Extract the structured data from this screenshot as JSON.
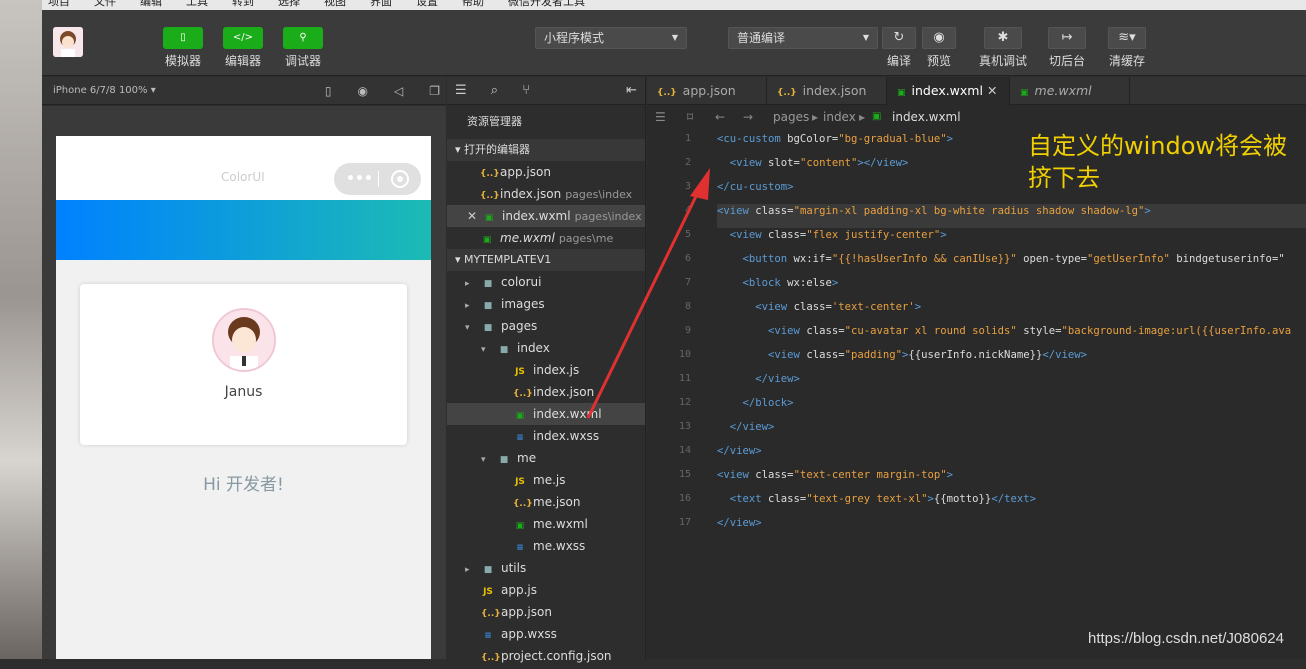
{
  "menubar": [
    "项目",
    "文件",
    "编辑",
    "工具",
    "转到",
    "选择",
    "视图",
    "界面",
    "设置",
    "帮助",
    "微信开发者工具"
  ],
  "toolbar": {
    "simulator": "模拟器",
    "editor": "编辑器",
    "debugger": "调试器",
    "mode": "小程序模式",
    "compile_mode": "普通编译",
    "compile": "编译",
    "preview": "预览",
    "remote_debug": "真机调试",
    "background": "切后台",
    "clear_cache": "清缓存"
  },
  "simulator": {
    "device": "iPhone 6/7/8 100% ▾",
    "nav_title": "ColorUI",
    "username": "Janus",
    "greeting": "Hi 开发者!"
  },
  "explorer": {
    "title": "资源管理器",
    "open_editors_label": "▾ 打开的编辑器",
    "open_editors": [
      {
        "name": "app.json",
        "hint": "",
        "type": "json",
        "close": false
      },
      {
        "name": "index.json",
        "hint": "pages\\index",
        "type": "json",
        "close": false
      },
      {
        "name": "index.wxml",
        "hint": "pages\\index",
        "type": "wxml",
        "close": true
      },
      {
        "name": "me.wxml",
        "hint": "pages\\me",
        "type": "wxml",
        "close": false
      }
    ],
    "project_label": "▾ MYTEMPLATEV1",
    "tree": [
      {
        "name": "colorui",
        "depth": 0,
        "caret": "▸",
        "type": "dir"
      },
      {
        "name": "images",
        "depth": 0,
        "caret": "▸",
        "type": "dir"
      },
      {
        "name": "pages",
        "depth": 0,
        "caret": "▾",
        "type": "dir"
      },
      {
        "name": "index",
        "depth": 1,
        "caret": "▾",
        "type": "dir"
      },
      {
        "name": "index.js",
        "depth": 2,
        "caret": "",
        "type": "js"
      },
      {
        "name": "index.json",
        "depth": 2,
        "caret": "",
        "type": "json"
      },
      {
        "name": "index.wxml",
        "depth": 2,
        "caret": "",
        "type": "wxml",
        "selected": true
      },
      {
        "name": "index.wxss",
        "depth": 2,
        "caret": "",
        "type": "wxss"
      },
      {
        "name": "me",
        "depth": 1,
        "caret": "▾",
        "type": "dir"
      },
      {
        "name": "me.js",
        "depth": 2,
        "caret": "",
        "type": "js"
      },
      {
        "name": "me.json",
        "depth": 2,
        "caret": "",
        "type": "json"
      },
      {
        "name": "me.wxml",
        "depth": 2,
        "caret": "",
        "type": "wxml"
      },
      {
        "name": "me.wxss",
        "depth": 2,
        "caret": "",
        "type": "wxss"
      },
      {
        "name": "utils",
        "depth": 0,
        "caret": "▸",
        "type": "dir"
      },
      {
        "name": "app.js",
        "depth": 0,
        "caret": "",
        "type": "js"
      },
      {
        "name": "app.json",
        "depth": 0,
        "caret": "",
        "type": "json"
      },
      {
        "name": "app.wxss",
        "depth": 0,
        "caret": "",
        "type": "wxss"
      },
      {
        "name": "project.config.json",
        "depth": 0,
        "caret": "",
        "type": "json"
      }
    ]
  },
  "editor": {
    "tabs": [
      {
        "label": "app.json",
        "type": "json"
      },
      {
        "label": "index.json",
        "type": "json"
      },
      {
        "label": "index.wxml",
        "type": "wxml",
        "active": true
      },
      {
        "label": "me.wxml",
        "type": "wxml"
      }
    ],
    "breadcrumb": [
      "pages",
      "index",
      "index.wxml"
    ],
    "lines": [
      [
        [
          "t",
          "<cu-custom "
        ],
        [
          "w",
          "bgColor="
        ],
        [
          "s",
          "\"bg-gradual-blue\""
        ],
        [
          "t",
          ">"
        ]
      ],
      [
        [
          "w",
          "  "
        ],
        [
          "t",
          "<view "
        ],
        [
          "w",
          "slot="
        ],
        [
          "s",
          "\"content\""
        ],
        [
          "t",
          "></view>"
        ]
      ],
      [
        [
          "t",
          "</cu-custom>"
        ]
      ],
      [
        [
          "t",
          "<view "
        ],
        [
          "w",
          "class="
        ],
        [
          "s",
          "\"margin-xl padding-xl bg-white radius shadow shadow-lg\""
        ],
        [
          "t",
          ">"
        ]
      ],
      [
        [
          "w",
          "  "
        ],
        [
          "t",
          "<view "
        ],
        [
          "w",
          "class="
        ],
        [
          "s",
          "\"flex justify-center\""
        ],
        [
          "t",
          ">"
        ]
      ],
      [
        [
          "w",
          "    "
        ],
        [
          "t",
          "<button "
        ],
        [
          "w",
          "wx:if="
        ],
        [
          "s",
          "\"{{!hasUserInfo && canIUse}}\""
        ],
        [
          "w",
          " open-type="
        ],
        [
          "s",
          "\"getUserInfo\""
        ],
        [
          "w",
          " bindgetuserinfo=\""
        ]
      ],
      [
        [
          "w",
          "    "
        ],
        [
          "t",
          "<block "
        ],
        [
          "w",
          "wx:else"
        ],
        [
          "t",
          ">"
        ]
      ],
      [
        [
          "w",
          "      "
        ],
        [
          "t",
          "<view "
        ],
        [
          "w",
          "class="
        ],
        [
          "s",
          "'text-center'"
        ],
        [
          "t",
          ">"
        ]
      ],
      [
        [
          "w",
          "        "
        ],
        [
          "t",
          "<view "
        ],
        [
          "w",
          "class="
        ],
        [
          "s",
          "\"cu-avatar xl round solids\""
        ],
        [
          "w",
          " style="
        ],
        [
          "s",
          "\"background-image:url({{userInfo.ava"
        ]
      ],
      [
        [
          "w",
          "        "
        ],
        [
          "t",
          "<view "
        ],
        [
          "w",
          "class="
        ],
        [
          "s",
          "\"padding\""
        ],
        [
          "t",
          ">"
        ],
        [
          "w",
          "{{userInfo.nickName}}"
        ],
        [
          "t",
          "</view>"
        ]
      ],
      [
        [
          "w",
          "      "
        ],
        [
          "t",
          "</view>"
        ]
      ],
      [
        [
          "w",
          "    "
        ],
        [
          "t",
          "</block>"
        ]
      ],
      [
        [
          "w",
          "  "
        ],
        [
          "t",
          "</view>"
        ]
      ],
      [
        [
          "t",
          "</view>"
        ]
      ],
      [
        [
          "t",
          "<view "
        ],
        [
          "w",
          "class="
        ],
        [
          "s",
          "\"text-center margin-top\""
        ],
        [
          "t",
          ">"
        ]
      ],
      [
        [
          "w",
          "  "
        ],
        [
          "t",
          "<text "
        ],
        [
          "w",
          "class="
        ],
        [
          "s",
          "\"text-grey text-xl\""
        ],
        [
          "t",
          ">"
        ],
        [
          "w",
          "{{motto}}"
        ],
        [
          "t",
          "</text>"
        ]
      ],
      [
        [
          "t",
          "</view>"
        ]
      ]
    ]
  },
  "annotation": "自定义的window将会被挤下去",
  "watermark": "https://blog.csdn.net/J080624",
  "colors": {
    "accent_green": "#1aad19",
    "gradient_start": "#0081ff",
    "gradient_end": "#1cbbb4",
    "annotation": "#f0d000",
    "arrow": "#e03030"
  }
}
